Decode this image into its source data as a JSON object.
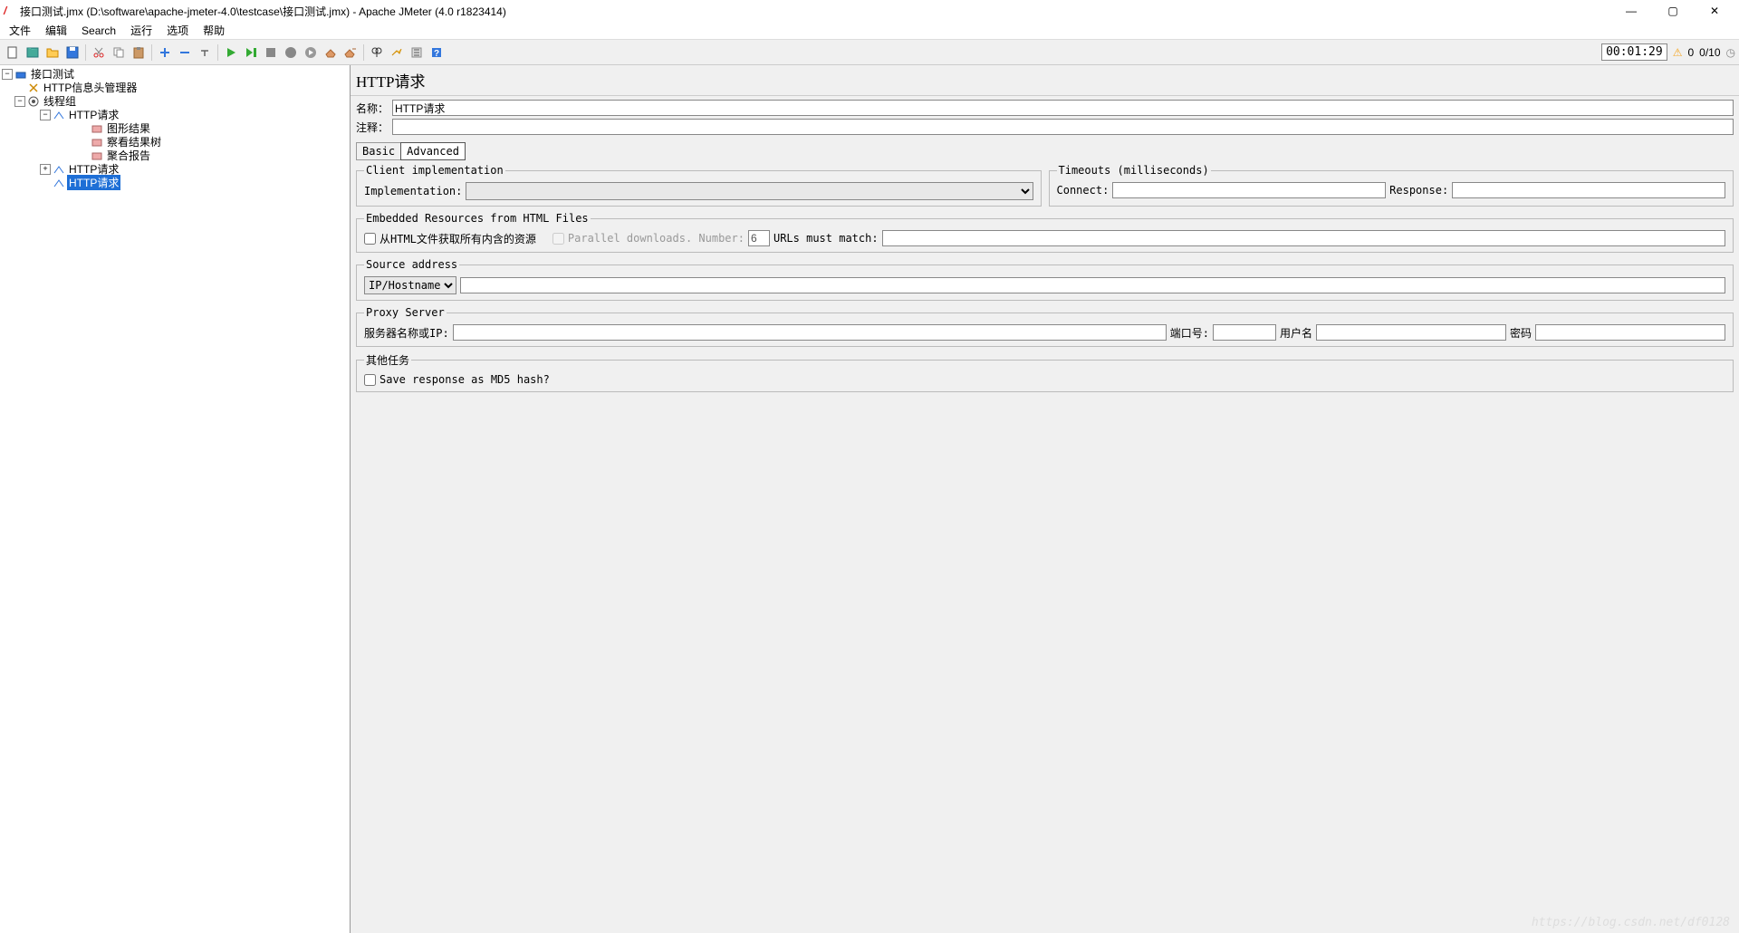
{
  "window": {
    "title": "接口测试.jmx (D:\\software\\apache-jmeter-4.0\\testcase\\接口测试.jmx) - Apache JMeter (4.0 r1823414)"
  },
  "menu": {
    "items": [
      "文件",
      "编辑",
      "Search",
      "运行",
      "选项",
      "帮助"
    ]
  },
  "status": {
    "timer": "00:01:29",
    "warn_count": "0",
    "thread_count": "0/10"
  },
  "tree": {
    "root": "接口测试",
    "header_mgr": "HTTP信息头管理器",
    "thread_group": "线程组",
    "http1": "HTTP请求",
    "graph_results": "图形结果",
    "view_results_tree": "察看结果树",
    "aggregate_report": "聚合报告",
    "http2": "HTTP请求",
    "http3": "HTTP请求"
  },
  "panel": {
    "heading": "HTTP请求",
    "name_label": "名称：",
    "name_value": "HTTP请求",
    "comment_label": "注释：",
    "comment_value": ""
  },
  "tabs": {
    "basic": "Basic",
    "advanced": "Advanced"
  },
  "client_impl": {
    "legend": "Client implementation",
    "label": "Implementation:"
  },
  "timeouts": {
    "legend": "Timeouts (milliseconds)",
    "connect": "Connect:",
    "response": "Response:"
  },
  "embedded": {
    "legend": "Embedded Resources from HTML Files",
    "retrieve": "从HTML文件获取所有内含的资源",
    "parallel": "Parallel downloads. Number:",
    "parallel_num": "6",
    "urls_match": "URLs must match:"
  },
  "source_addr": {
    "legend": "Source address",
    "select": "IP/Hostname"
  },
  "proxy": {
    "legend": "Proxy Server",
    "server": "服务器名称或IP:",
    "port": "端口号:",
    "user": "用户名",
    "pass": "密码"
  },
  "optional": {
    "legend": "其他任务",
    "md5": "Save response as MD5 hash?"
  },
  "watermark": "https://blog.csdn.net/df0128"
}
